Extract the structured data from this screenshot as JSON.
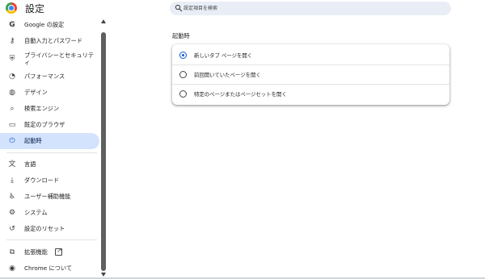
{
  "app": {
    "title": "設定"
  },
  "search": {
    "placeholder": "設定項目を検索",
    "icon": "search-icon"
  },
  "sidebar": {
    "items": [
      {
        "label": "Google の設定",
        "icon": "google-g-icon",
        "glyph": "G"
      },
      {
        "label": "自動入力とパスワード",
        "icon": "key-icon",
        "glyph": "⚷"
      },
      {
        "label": "プライバシーとセキュリティ",
        "icon": "shield-icon",
        "glyph": "⛨"
      },
      {
        "label": "パフォーマンス",
        "icon": "speedometer-icon",
        "glyph": "◔"
      },
      {
        "label": "デザイン",
        "icon": "palette-icon",
        "glyph": "◍"
      },
      {
        "label": "検索エンジン",
        "icon": "search-icon",
        "glyph": "⌕"
      },
      {
        "label": "既定のブラウザ",
        "icon": "browser-window-icon",
        "glyph": "▭"
      },
      {
        "label": "起動時",
        "icon": "power-icon",
        "glyph": "⏻",
        "active": true
      },
      {
        "label": "言語",
        "icon": "translate-icon",
        "glyph": "文"
      },
      {
        "label": "ダウンロード",
        "icon": "download-icon",
        "glyph": "⤓"
      },
      {
        "label": "ユーザー補助機能",
        "icon": "accessibility-icon",
        "glyph": "♿"
      },
      {
        "label": "システム",
        "icon": "wrench-icon",
        "glyph": "⚙"
      },
      {
        "label": "設定のリセット",
        "icon": "reset-icon",
        "glyph": "↺"
      },
      {
        "label": "拡張機能",
        "icon": "puzzle-icon",
        "glyph": "⧉"
      },
      {
        "label": "Chrome について",
        "icon": "chrome-icon",
        "glyph": "◉"
      }
    ]
  },
  "main": {
    "section_title": "起動時",
    "options": [
      {
        "label": "新しいタブ ページを開く",
        "selected": true
      },
      {
        "label": "前回開いていたページを開く",
        "selected": false
      },
      {
        "label": "特定のページまたはページセットを開く",
        "selected": false
      }
    ]
  },
  "colors": {
    "accent": "#0b57d0",
    "active_bg": "#d3e3fd",
    "search_bg": "#e9eef6"
  }
}
